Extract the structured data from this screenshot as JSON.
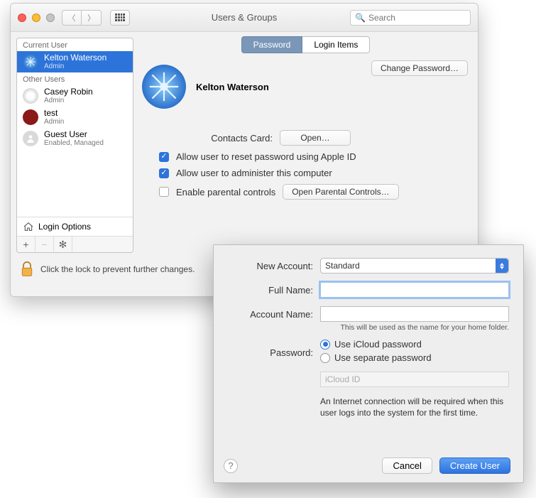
{
  "window": {
    "title": "Users & Groups",
    "search_placeholder": "Search"
  },
  "sidebar": {
    "current_header": "Current User",
    "other_header": "Other Users",
    "users": [
      {
        "name": "Kelton Waterson",
        "role": "Admin"
      },
      {
        "name": "Casey Robin",
        "role": "Admin"
      },
      {
        "name": "test",
        "role": "Admin"
      },
      {
        "name": "Guest User",
        "role": "Enabled, Managed"
      }
    ],
    "login_options": "Login Options"
  },
  "tabs": {
    "password": "Password",
    "login_items": "Login Items"
  },
  "detail": {
    "name": "Kelton Waterson",
    "change_password": "Change Password…",
    "contacts_label": "Contacts Card:",
    "open": "Open…",
    "allow_reset": "Allow user to reset password using Apple ID",
    "allow_admin": "Allow user to administer this computer",
    "enable_parental": "Enable parental controls",
    "open_parental": "Open Parental Controls…"
  },
  "lock_text": "Click the lock to prevent further changes.",
  "sheet": {
    "new_account_label": "New Account:",
    "new_account_value": "Standard",
    "full_name_label": "Full Name:",
    "full_name_value": "",
    "account_name_label": "Account Name:",
    "account_name_value": "",
    "account_name_hint": "This will be used as the name for your home folder.",
    "password_label": "Password:",
    "pwd_opt_icloud": "Use iCloud password",
    "pwd_opt_separate": "Use separate password",
    "icloud_placeholder": "iCloud ID",
    "info": "An Internet connection will be required when this user logs into the system for the first time.",
    "cancel": "Cancel",
    "create": "Create User"
  }
}
